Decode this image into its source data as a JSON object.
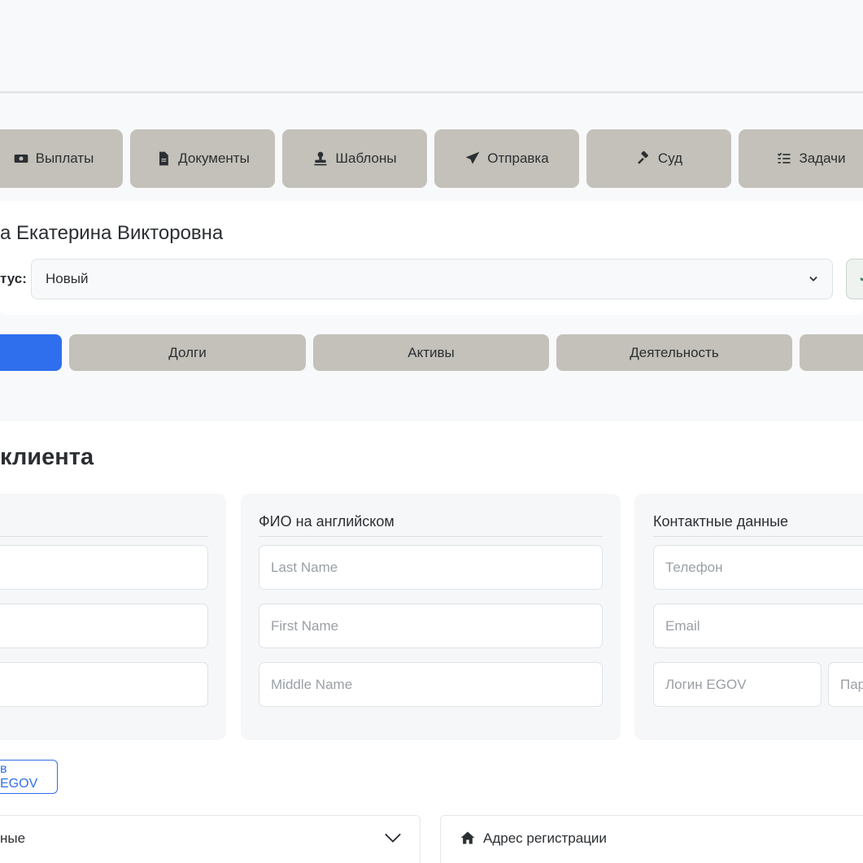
{
  "toolbar": {
    "buttons": [
      {
        "label": "Выплаты",
        "icon": "money-bill-icon"
      },
      {
        "label": "Документы",
        "icon": "file-icon"
      },
      {
        "label": "Шаблоны",
        "icon": "stamp-icon"
      },
      {
        "label": "Отправка",
        "icon": "paper-plane-icon"
      },
      {
        "label": "Суд",
        "icon": "gavel-icon"
      },
      {
        "label": "Задачи",
        "icon": "list-check-icon"
      }
    ]
  },
  "client": {
    "name_visible": "а Екатерина Викторовна",
    "status_label": "тус:",
    "status_value": "Новый"
  },
  "nav_tabs": [
    {
      "label": "",
      "active": true
    },
    {
      "label": "Долги",
      "active": false
    },
    {
      "label": "Активы",
      "active": false
    },
    {
      "label": "Деятельность",
      "active": false
    },
    {
      "label": "",
      "active": false
    }
  ],
  "section": {
    "title_visible": "клиента",
    "panels": [
      {
        "title": "",
        "fields": [
          "",
          "",
          ""
        ]
      },
      {
        "title": "ФИО на английском",
        "fields": [
          "Last Name",
          "First Name",
          "Middle Name"
        ]
      },
      {
        "title": "Контактные данные",
        "fields": [
          "Телефон",
          "Email",
          "Логин EGOV",
          "Пар"
        ]
      }
    ],
    "egov_button": "в EGOV",
    "accordion_left": "ные",
    "accordion_right": "Адрес регистрации"
  },
  "colors": {
    "accent": "#2f6fed",
    "tool_bg": "#c3c1b9",
    "page_bg": "#f8f9fa"
  }
}
